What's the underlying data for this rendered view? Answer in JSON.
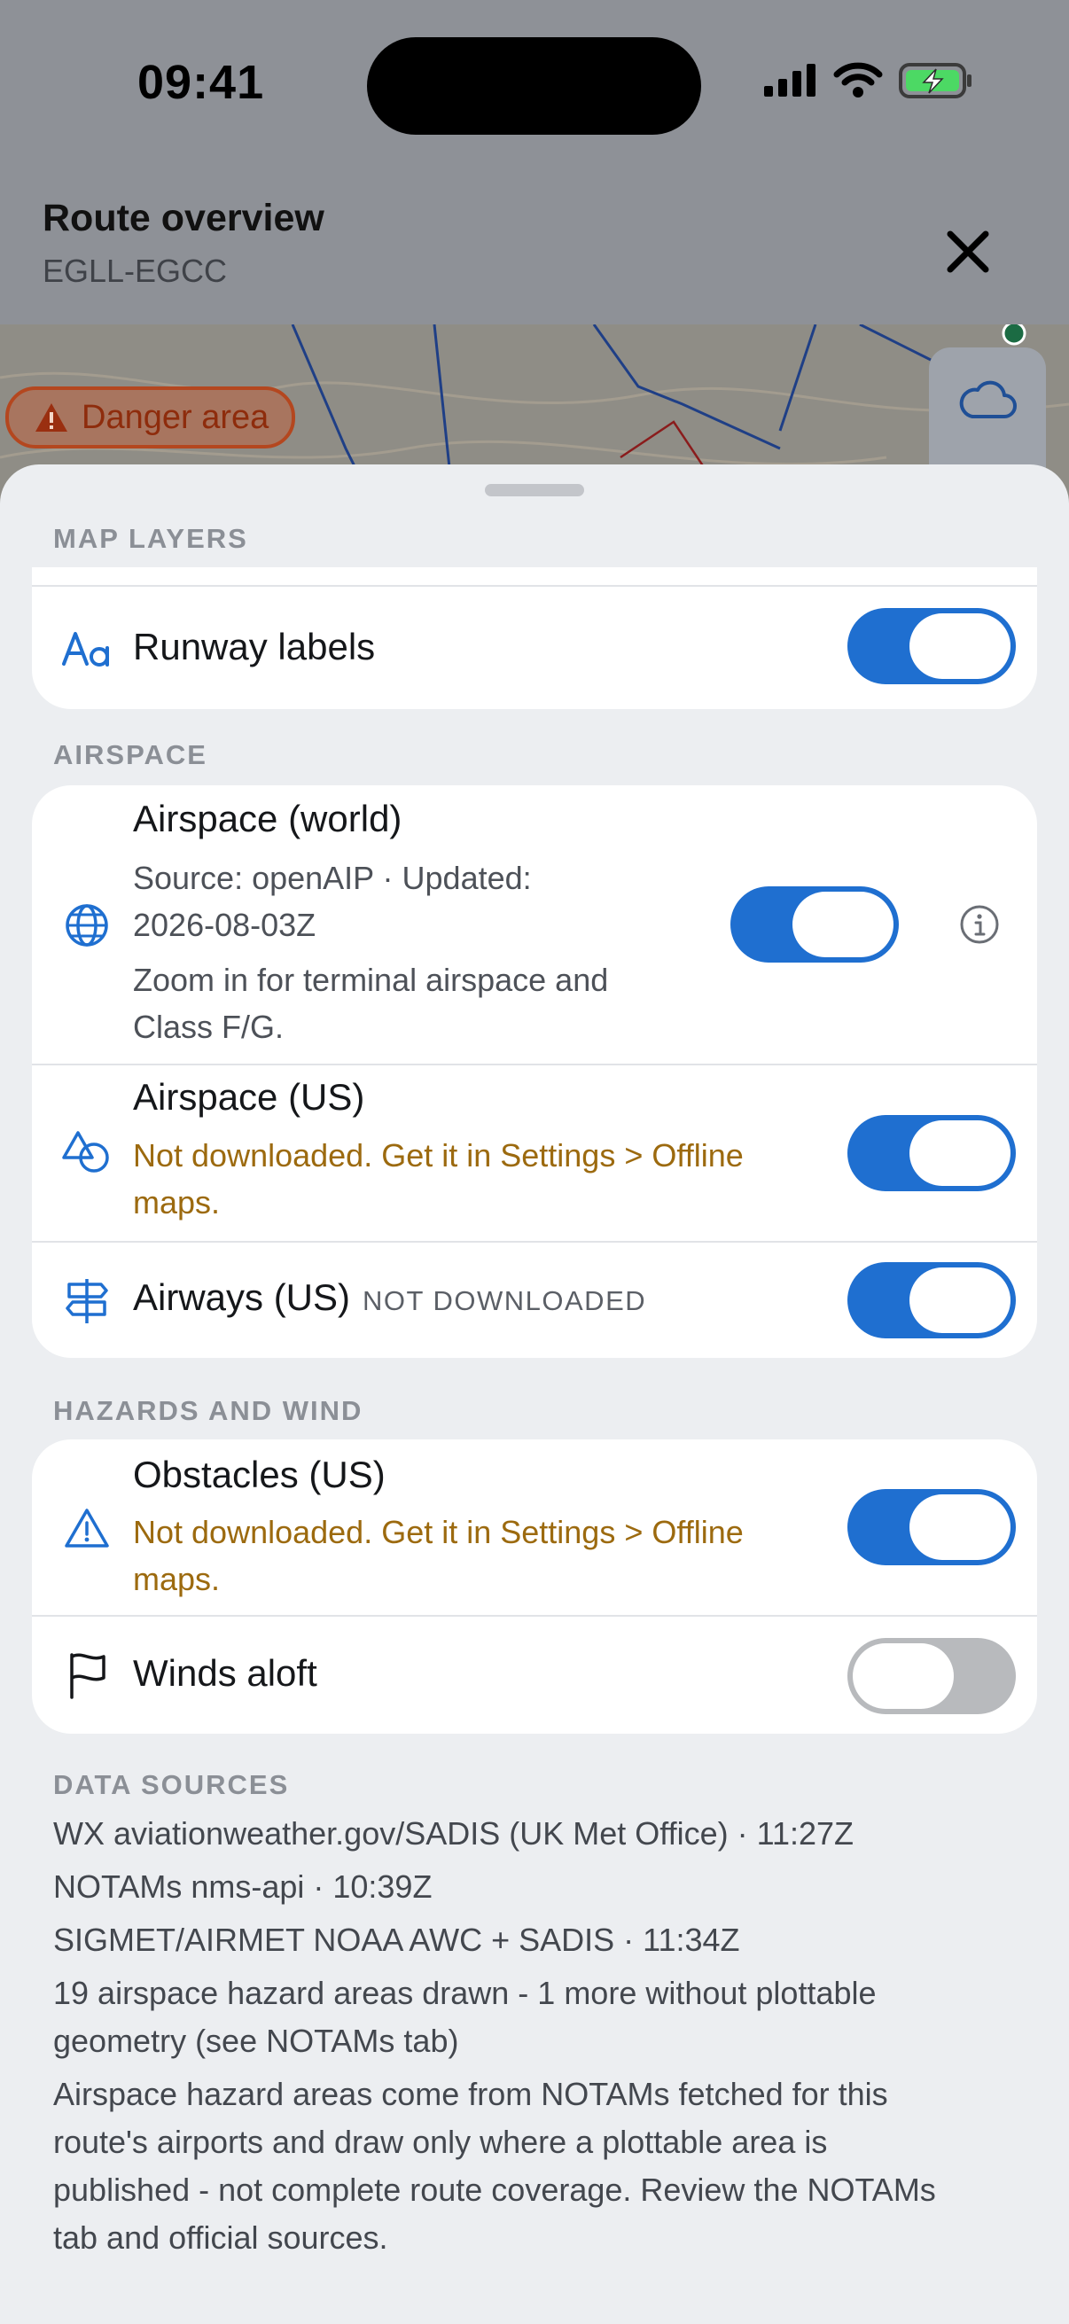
{
  "status_bar": {
    "time": "09:41"
  },
  "header": {
    "title": "Route overview",
    "subtitle": "EGLL-EGCC"
  },
  "map": {
    "danger_chip_label": "Danger area"
  },
  "sections": {
    "map_layers": {
      "label": "MAP LAYERS",
      "runway_labels": {
        "title": "Runway labels",
        "icon": "text-aa-icon",
        "enabled": true
      }
    },
    "airspace": {
      "label": "AIRSPACE",
      "world": {
        "title": "Airspace (world)",
        "source_line1": "Source: openAIP · Updated:",
        "source_line2": "2026-08-03Z",
        "hint_line1": "Zoom in for terminal airspace and",
        "hint_line2": "Class F/G.",
        "icon": "globe-icon",
        "enabled": true
      },
      "us": {
        "title": "Airspace (US)",
        "warning_line1": "Not downloaded. Get it in Settings > Offline",
        "warning_line2": "maps.",
        "icon": "shapes-icon",
        "enabled": true
      },
      "airways": {
        "title": "Airways (US)",
        "tag": "NOT DOWNLOADED",
        "icon": "signpost-icon",
        "enabled": true
      }
    },
    "hazards": {
      "label": "HAZARDS AND WIND",
      "obstacles": {
        "title": "Obstacles (US)",
        "warning_line1": "Not downloaded. Get it in Settings > Offline",
        "warning_line2": "maps.",
        "icon": "warning-triangle-icon",
        "enabled": true
      },
      "winds": {
        "title": "Winds aloft",
        "icon": "flag-icon",
        "enabled": false
      }
    },
    "data_sources": {
      "label": "DATA SOURCES",
      "wx": "WX aviationweather.gov/SADIS (UK Met Office) · 11:27Z",
      "notams": "NOTAMs nms-api · 10:39Z",
      "sigmet": "SIGMET/AIRMET NOAA AWC + SADIS · 11:34Z",
      "hazard_count_line1": "19 airspace hazard areas drawn - 1 more without plottable",
      "hazard_count_line2": "geometry (see NOTAMs tab)",
      "disclaimer_line1": "Airspace hazard areas come from NOTAMs fetched for this",
      "disclaimer_line2": "route's airports and draw only where a plottable area is",
      "disclaimer_line3": "published - not complete route coverage. Review the NOTAMs",
      "disclaimer_line4": "tab and official sources."
    }
  },
  "colors": {
    "accent": "#1f6fd0",
    "warning_text": "#9c6a0f",
    "danger": "#b4471f",
    "sheet_bg": "#eceef1",
    "dimmed_bg": "#8e9197"
  }
}
